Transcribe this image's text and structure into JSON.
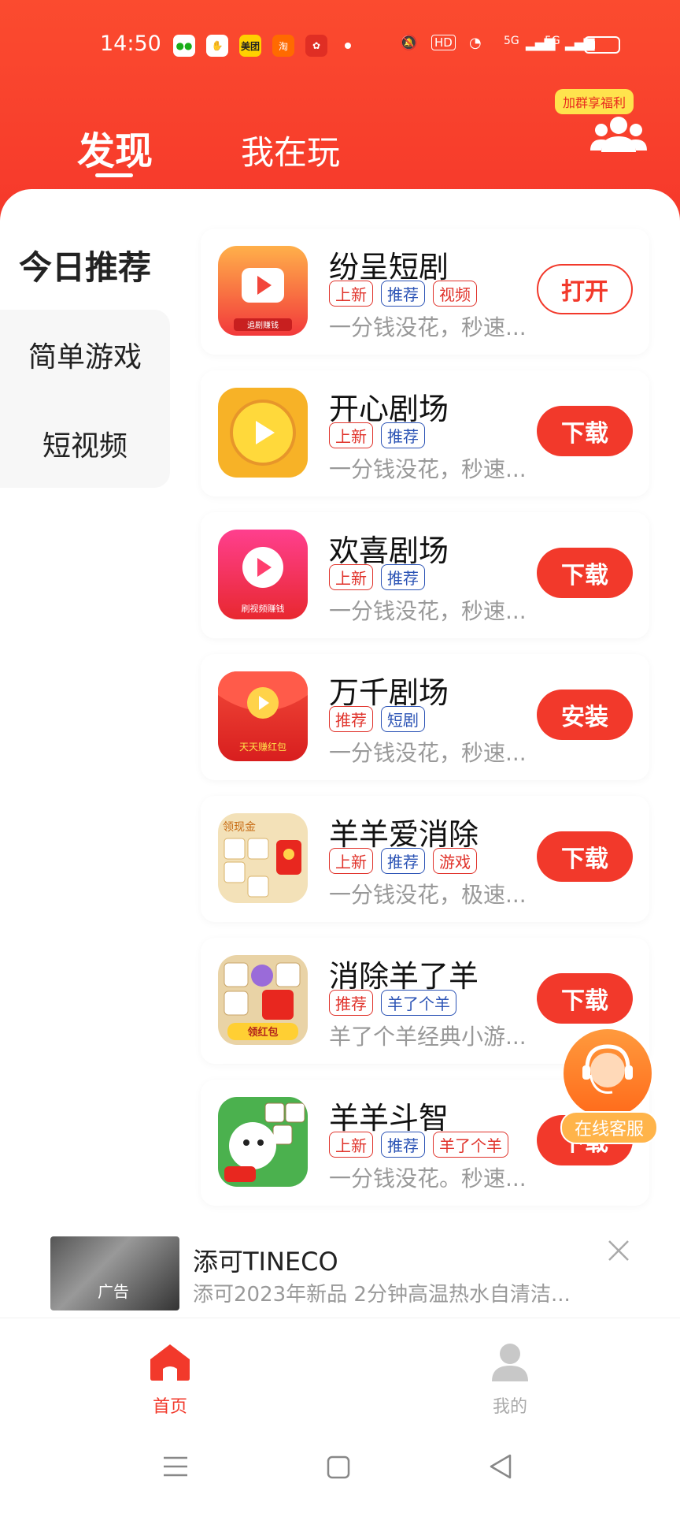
{
  "status_bar": {
    "time": "14:50",
    "app_icons": [
      "wechat-icon",
      "baidu-icon",
      "meituan-icon",
      "taobao-icon",
      "pinduoduo-icon"
    ],
    "meituan_label": "美团",
    "right": {
      "hd": "HD",
      "net1": "5G",
      "net2": "5G"
    }
  },
  "header": {
    "tabs": [
      {
        "label": "发现",
        "active": true
      },
      {
        "label": "我在玩",
        "active": false
      }
    ],
    "group_badge": "加群享福利"
  },
  "sidebar": {
    "items": [
      {
        "label": "今日推荐",
        "active": true
      },
      {
        "label": "简单游戏",
        "active": false
      },
      {
        "label": "短视频",
        "active": false
      }
    ]
  },
  "apps": [
    {
      "name": "纷呈短剧",
      "tags": [
        "上新",
        "推荐",
        "视频"
      ],
      "desc": "一分钱没花，秒速...",
      "action": "打开"
    },
    {
      "name": "开心剧场",
      "tags": [
        "上新",
        "推荐"
      ],
      "desc": "一分钱没花，秒速...",
      "action": "下载"
    },
    {
      "name": "欢喜剧场",
      "tags": [
        "上新",
        "推荐"
      ],
      "desc": "一分钱没花，秒速...",
      "action": "下载"
    },
    {
      "name": "万千剧场",
      "tags": [
        "推荐",
        "短剧"
      ],
      "desc": "一分钱没花，秒速...",
      "action": "安装"
    },
    {
      "name": "羊羊爱消除",
      "tags": [
        "上新",
        "推荐",
        "游戏"
      ],
      "desc": "一分钱没花，极速...",
      "action": "下载"
    },
    {
      "name": "消除羊了羊",
      "tags": [
        "推荐",
        "羊了个羊"
      ],
      "desc": "羊了个羊经典小游...",
      "action": "下载"
    },
    {
      "name": "羊羊斗智",
      "tags": [
        "上新",
        "推荐",
        "羊了个羊"
      ],
      "desc": "一分钱没花。秒速...",
      "action": "下载"
    }
  ],
  "icon_texts": [
    "追剧赚钱",
    "刷视频赚钱",
    "天天赚红包",
    "领现金",
    "领红包"
  ],
  "service": {
    "label": "在线客服"
  },
  "ad": {
    "title": "添可TINECO",
    "desc": "添可2023年新品 2分钟高温热水自清洁...",
    "tag": "广告"
  },
  "bottom_nav": [
    {
      "label": "首页",
      "active": true
    },
    {
      "label": "我的",
      "active": false
    }
  ],
  "colors": {
    "brand": "#f2392b",
    "tag_red": "#e0332b",
    "tag_blue": "#2b53b5"
  }
}
